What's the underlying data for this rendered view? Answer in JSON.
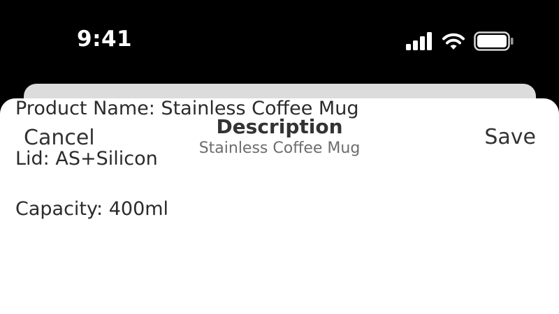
{
  "status_bar": {
    "time": "9:41",
    "icons": [
      "signal-icon",
      "wifi-icon",
      "battery-icon"
    ]
  },
  "nav": {
    "cancel_label": "Cancel",
    "title": "Description",
    "subtitle": "Stainless Coffee Mug",
    "save_label": "Save"
  },
  "description_lines": [
    "Product Name: Stainless Coffee Mug",
    "Lid: AS+Silicon",
    "Capacity: 400ml"
  ],
  "colors": {
    "background": "#000000",
    "sheet": "#ffffff",
    "back_sheet": "#dcdcdc",
    "text_primary": "#333333",
    "text_secondary": "#6d6d6d"
  }
}
